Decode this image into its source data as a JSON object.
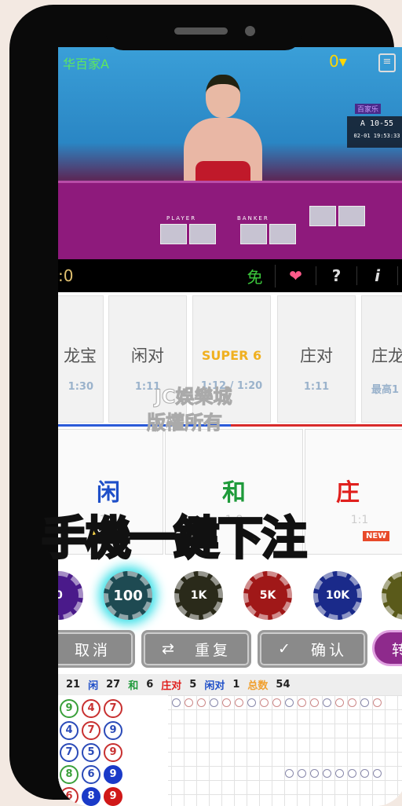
{
  "header": {
    "title": "华百家A",
    "balance_suffix": "0",
    "table_tag": "百家乐",
    "round": "A 10-55",
    "datetime": "02-01 19:53:33",
    "player_label": "PLAYER",
    "banker_label": "BANKER"
  },
  "toolbar": {
    "score": ":0",
    "free": "免",
    "help": "?",
    "info": "i"
  },
  "side_bets": [
    {
      "name": "龙宝",
      "odds": "1:30"
    },
    {
      "name": "闲对",
      "odds": "1:11"
    },
    {
      "name": "SUPER 6",
      "odds": "1:12 / 1:20"
    },
    {
      "name": "庄对",
      "odds": "1:11"
    },
    {
      "name": "庄龙",
      "odds": "最高1"
    }
  ],
  "main_bets": [
    {
      "name": "闲",
      "odds": "1:1",
      "color": "#1f4fc8"
    },
    {
      "name": "和",
      "odds": "1:8",
      "color": "#1e9a3a"
    },
    {
      "name": "庄",
      "odds": "1:1",
      "color": "#e0201e"
    }
  ],
  "chips": [
    {
      "label": "0",
      "color": "#4a1a8a"
    },
    {
      "label": "100",
      "color": "#1e4a52",
      "selected": true
    },
    {
      "label": "1K",
      "color": "#2a2a1a"
    },
    {
      "label": "5K",
      "color": "#a01818"
    },
    {
      "label": "10K",
      "color": "#1a2a8a"
    },
    {
      "label": "",
      "color": "#5a5a1a"
    }
  ],
  "new_badge": "NEW",
  "buttons": {
    "cancel": "取消",
    "repeat": "重复",
    "confirm": "确认",
    "switch": "转"
  },
  "stats": [
    {
      "label": "",
      "value": "21",
      "color": "#333"
    },
    {
      "label": "闲",
      "value": "27",
      "color": "#1f4fc8"
    },
    {
      "label": "和",
      "value": "6",
      "color": "#1e9a3a"
    },
    {
      "label": "庄对",
      "value": "5",
      "color": "#e0201e"
    },
    {
      "label": "闲对",
      "value": "1",
      "color": "#1f4fc8"
    },
    {
      "label": "总数",
      "value": "54",
      "color": "#f0a030"
    }
  ],
  "bead_road": [
    [
      "9",
      "4",
      "7"
    ],
    [
      "4",
      "7",
      "9"
    ],
    [
      "7",
      "5",
      "9"
    ],
    [
      "8",
      "6",
      "9"
    ],
    [
      "6",
      "8",
      "9"
    ]
  ],
  "bead_colors": [
    [
      "g",
      "r",
      "r"
    ],
    [
      "b",
      "r",
      "b"
    ],
    [
      "b",
      "b",
      "r"
    ],
    [
      "g",
      "b",
      "B"
    ],
    [
      "r",
      "B",
      "R"
    ]
  ],
  "overlay": "手機一鍵下注",
  "watermark": [
    "JC娛樂城",
    "版權所有"
  ]
}
